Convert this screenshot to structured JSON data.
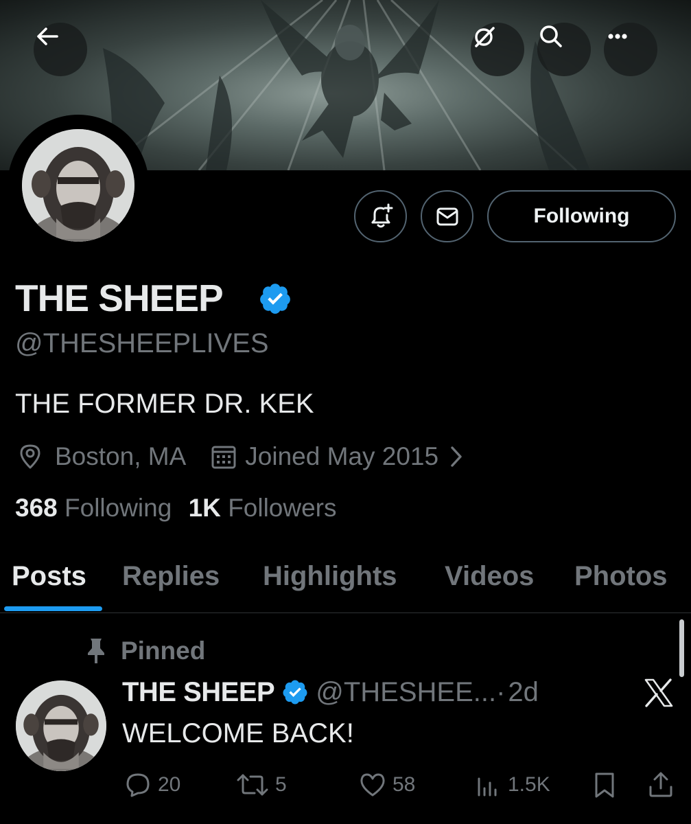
{
  "header": {
    "back_icon": "arrow-left-icon",
    "grok_icon": "grok-icon",
    "search_icon": "search-icon",
    "more_icon": "more-horizontal-icon"
  },
  "profile": {
    "name": "THE SHEEP",
    "verified": true,
    "handle": "@THESHEEPLIVES",
    "bio": "THE FORMER DR. KEK",
    "location": "Boston, MA",
    "joined": "Joined May 2015",
    "following_count": "368",
    "following_label": "Following",
    "followers_count": "1K",
    "followers_label": "Followers",
    "follow_button_label": "Following"
  },
  "tabs": [
    {
      "label": "Posts",
      "active": true
    },
    {
      "label": "Replies",
      "active": false
    },
    {
      "label": "Highlights",
      "active": false
    },
    {
      "label": "Videos",
      "active": false
    },
    {
      "label": "Photos",
      "active": false
    }
  ],
  "pinned_post": {
    "pinned_label": "Pinned",
    "author_name": "THE SHEEP",
    "author_handle": "@THESHEE...",
    "separator": "·",
    "time": "2d",
    "text": "WELCOME BACK!",
    "replies": "20",
    "reposts": "5",
    "likes": "58",
    "views": "1.5K"
  },
  "colors": {
    "accent": "#1d9bf0",
    "secondary_text": "#71767b",
    "primary_text": "#e7e9ea",
    "background": "#000000",
    "border": "#536471"
  }
}
